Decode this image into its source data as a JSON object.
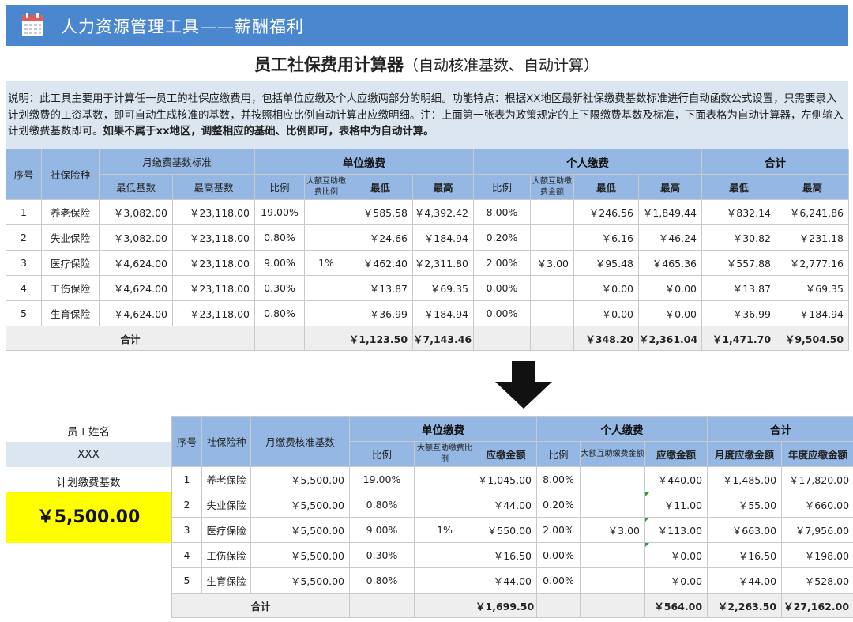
{
  "banner": {
    "icon": "calendar-icon",
    "title": "人力资源管理工具——薪酬福利"
  },
  "main_title": {
    "bold": "员工社保费用计算器",
    "sub": "（自动核准基数、自动计算）"
  },
  "description": {
    "text": "说明：此工具主要用于计算任一员工的社保应缴费用，包括单位应缴及个人应缴两部分的明细。功能特点：根据XX地区最新社保缴费基数标准进行自动函数公式设置，只需要录入计划缴费的工资基数，即可自动生成核准的基数，并按照相应比例自动计算出应缴明细。注：上面第一张表为政策规定的上下限缴费基数及标准，下面表格为自动计算器，左侧输入计划缴费基数即可。",
    "bold": "如果不属于xx地区，调整相应的基础、比例即可，表格中为自动计算。"
  },
  "table1": {
    "header": {
      "no": "序号",
      "type": "社保险种",
      "base_group": "月缴费基数标准",
      "company_group": "单位缴费",
      "personal_group": "个人缴费",
      "total_group": "合计",
      "min_base": "最低基数",
      "max_base": "最高基数",
      "c_ratio": "比例",
      "c_mutual": "大额互助缴费比例",
      "c_min": "最低",
      "c_max": "最高",
      "p_ratio": "比例",
      "p_mutual": "大额互助缴费金额",
      "p_min": "最低",
      "p_max": "最高",
      "t_min": "最低",
      "t_max": "最高"
    },
    "rows": [
      {
        "no": "1",
        "type": "养老保险",
        "min_base": "￥3,082.00",
        "max_base": "￥23,118.00",
        "c_ratio": "19.00%",
        "c_mutual": "",
        "c_min": "￥585.58",
        "c_max": "￥4,392.42",
        "p_ratio": "8.00%",
        "p_mutual": "",
        "p_min": "￥246.56",
        "p_max": "￥1,849.44",
        "t_min": "￥832.14",
        "t_max": "￥6,241.86"
      },
      {
        "no": "2",
        "type": "失业保险",
        "min_base": "￥3,082.00",
        "max_base": "￥23,118.00",
        "c_ratio": "0.80%",
        "c_mutual": "",
        "c_min": "￥24.66",
        "c_max": "￥184.94",
        "p_ratio": "0.20%",
        "p_mutual": "",
        "p_min": "￥6.16",
        "p_max": "￥46.24",
        "t_min": "￥30.82",
        "t_max": "￥231.18"
      },
      {
        "no": "3",
        "type": "医疗保险",
        "min_base": "￥4,624.00",
        "max_base": "￥23,118.00",
        "c_ratio": "9.00%",
        "c_mutual": "1%",
        "c_min": "￥462.40",
        "c_max": "￥2,311.80",
        "p_ratio": "2.00%",
        "p_mutual": "￥3.00",
        "p_min": "￥95.48",
        "p_max": "￥465.36",
        "t_min": "￥557.88",
        "t_max": "￥2,777.16"
      },
      {
        "no": "4",
        "type": "工伤保险",
        "min_base": "￥4,624.00",
        "max_base": "￥23,118.00",
        "c_ratio": "0.30%",
        "c_mutual": "",
        "c_min": "￥13.87",
        "c_max": "￥69.35",
        "p_ratio": "0.00%",
        "p_mutual": "",
        "p_min": "￥0.00",
        "p_max": "￥0.00",
        "t_min": "￥13.87",
        "t_max": "￥69.35"
      },
      {
        "no": "5",
        "type": "生育保险",
        "min_base": "￥4,624.00",
        "max_base": "￥23,118.00",
        "c_ratio": "0.80%",
        "c_mutual": "",
        "c_min": "￥36.99",
        "c_max": "￥184.94",
        "p_ratio": "0.00%",
        "p_mutual": "",
        "p_min": "￥0.00",
        "p_max": "￥0.00",
        "t_min": "￥36.99",
        "t_max": "￥184.94"
      }
    ],
    "total": {
      "label": "合计",
      "c_min": "￥1,123.50",
      "c_max": "￥7,143.46",
      "p_min": "￥348.20",
      "p_max": "￥2,361.04",
      "t_min": "￥1,471.70",
      "t_max": "￥9,504.50"
    }
  },
  "arrow": {
    "icon": "down-arrow-icon"
  },
  "left_panel": {
    "name_label": "员工姓名",
    "name_value": "XXX",
    "base_label": "计划缴费基数",
    "base_value": "￥5,500.00"
  },
  "table2": {
    "header": {
      "no": "序号",
      "type": "社保险种",
      "base": "月缴费核准基数",
      "company_group": "单位缴费",
      "personal_group": "个人缴费",
      "total_group": "合计",
      "c_ratio": "比例",
      "c_mutual": "大额互助缴费比例",
      "c_amount": "应缴金额",
      "p_ratio": "比例",
      "p_mutual": "大额互助缴费金额",
      "p_amount": "应缴金额",
      "monthly": "月度应缴金额",
      "yearly": "年度应缴金额"
    },
    "rows": [
      {
        "no": "1",
        "type": "养老保险",
        "base": "￥5,500.00",
        "c_ratio": "19.00%",
        "c_mutual": "",
        "c_amount": "￥1,045.00",
        "p_ratio": "8.00%",
        "p_mutual": "",
        "p_amount": "￥440.00",
        "monthly": "￥1,485.00",
        "yearly": "￥17,820.00"
      },
      {
        "no": "2",
        "type": "失业保险",
        "base": "￥5,500.00",
        "c_ratio": "0.80%",
        "c_mutual": "",
        "c_amount": "￥44.00",
        "p_ratio": "0.20%",
        "p_mutual": "",
        "p_amount": "￥11.00",
        "monthly": "￥55.00",
        "yearly": "￥660.00"
      },
      {
        "no": "3",
        "type": "医疗保险",
        "base": "￥5,500.00",
        "c_ratio": "9.00%",
        "c_mutual": "1%",
        "c_amount": "￥550.00",
        "p_ratio": "2.00%",
        "p_mutual": "￥3.00",
        "p_amount": "￥113.00",
        "monthly": "￥663.00",
        "yearly": "￥7,956.00"
      },
      {
        "no": "4",
        "type": "工伤保险",
        "base": "￥5,500.00",
        "c_ratio": "0.30%",
        "c_mutual": "",
        "c_amount": "￥16.50",
        "p_ratio": "0.00%",
        "p_mutual": "",
        "p_amount": "￥0.00",
        "monthly": "￥16.50",
        "yearly": "￥198.00"
      },
      {
        "no": "5",
        "type": "生育保险",
        "base": "￥5,500.00",
        "c_ratio": "0.80%",
        "c_mutual": "",
        "c_amount": "￥44.00",
        "p_ratio": "0.00%",
        "p_mutual": "",
        "p_amount": "￥0.00",
        "monthly": "￥44.00",
        "yearly": "￥528.00"
      }
    ],
    "total": {
      "label": "合计",
      "c_amount": "￥1,699.50",
      "p_amount": "￥564.00",
      "monthly": "￥2,263.50",
      "yearly": "￥27,162.00"
    }
  },
  "colors": {
    "banner": "#4a87cf",
    "header": "#94b7e3",
    "desc_bg": "#dbe6f1",
    "highlight": "#ffff00",
    "total_bg": "#eeeeee"
  }
}
